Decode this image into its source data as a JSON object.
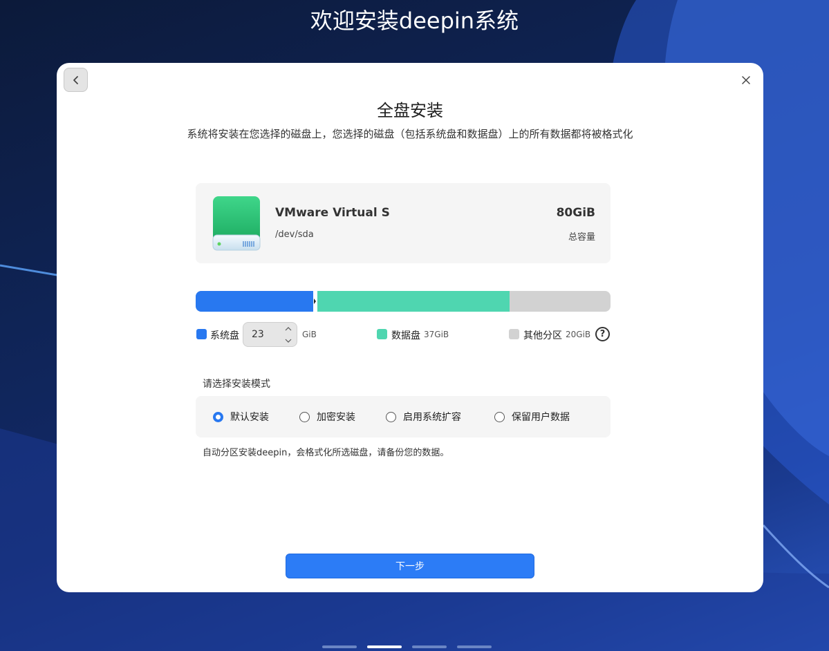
{
  "window": {
    "title": "欢迎安装deepin系统"
  },
  "header": {
    "back_icon": "chevron-left-icon",
    "close_icon": "close-icon"
  },
  "page": {
    "title": "全盘安装",
    "description": "系统将安装在您选择的磁盘上，您选择的磁盘（包括系统盘和数据盘）上的所有数据都将被格式化"
  },
  "disk": {
    "icon": "hard-drive-icon",
    "name": "VMware Virtual S",
    "path": "/dev/sda",
    "size": "80GiB",
    "size_label": "总容量"
  },
  "partitions": {
    "system": {
      "label": "系统盘",
      "value": "23",
      "unit": "GiB",
      "color": "#2878f0"
    },
    "data": {
      "label": "数据盘",
      "value": "37GiB",
      "color": "#4fd6b0"
    },
    "other": {
      "label": "其他分区",
      "value": "20GiB",
      "color": "#d2d2d2"
    },
    "help_icon": "help-icon",
    "help_symbol": "?",
    "bar_fractions": {
      "system": 0.2875,
      "data": 0.4625,
      "other": 0.25
    }
  },
  "install_mode": {
    "title": "请选择安装模式",
    "options": [
      {
        "label": "默认安装",
        "checked": true
      },
      {
        "label": "加密安装",
        "checked": false
      },
      {
        "label": "启用系统扩容",
        "checked": false
      },
      {
        "label": "保留用户数据",
        "checked": false
      }
    ],
    "description": "自动分区安装deepin，会格式化所选磁盘，请备份您的数据。"
  },
  "footer": {
    "next_label": "下一步"
  },
  "pager": {
    "total": 4,
    "current": 2
  }
}
